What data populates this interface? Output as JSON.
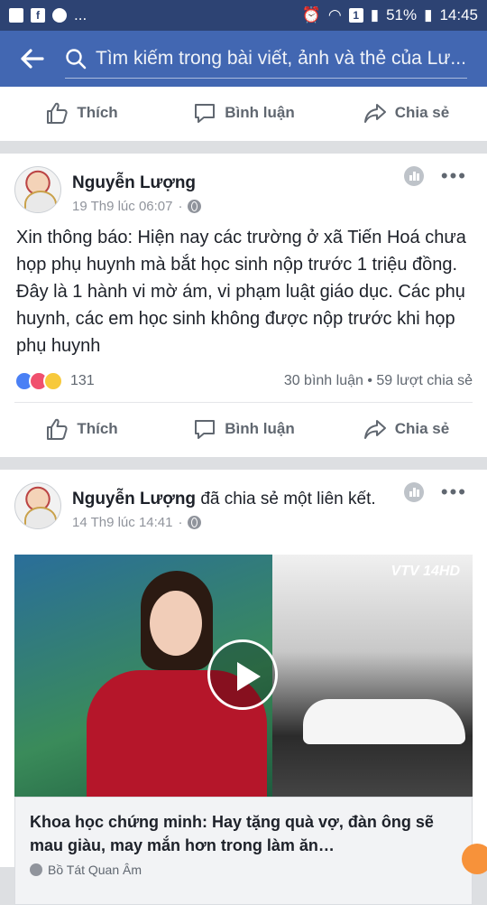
{
  "status_bar": {
    "left_icons": [
      "image-icon",
      "facebook-icon",
      "messenger-icon"
    ],
    "dots": "...",
    "network_badge": "1",
    "battery": "51%",
    "time": "14:45"
  },
  "search": {
    "placeholder": "Tìm kiếm trong bài viết, ảnh và thẻ của Lư..."
  },
  "actions": {
    "like": "Thích",
    "comment": "Bình luận",
    "share": "Chia sẻ"
  },
  "post1": {
    "author": "Nguyễn Lượng",
    "time": "19 Th9 lúc 06:07",
    "dot": "·",
    "text": "Xin thông báo: Hiện nay các trường ở xã Tiến Hoá chưa họp phụ huynh mà bắt học sinh nộp trước 1 triệu đồng. Đây là 1 hành vi mờ ám, vi phạm luật giáo dục. Các phụ huynh, các em học sinh không được nộp trước khi họp phụ huynh",
    "reaction_count": "131",
    "comments": "30 bình luận",
    "separator": "•",
    "shares": "59 lượt chia sẻ"
  },
  "post2": {
    "author": "Nguyễn Lượng",
    "action": "đã chia sẻ một liên kết.",
    "time": "14 Th9 lúc 14:41",
    "dot": "·",
    "video_logo": "VTV 14HD",
    "link_title": "Khoa học chứng minh: Hay tặng quà vợ, đàn ông sẽ mau giàu, may mắn hơn trong làm ăn…",
    "link_source": "Bồ Tát Quan Âm"
  },
  "colors": {
    "fb_blue": "#4267b2",
    "status_bar": "#2d4373",
    "text_gray": "#606770",
    "meta_gray": "#90949c"
  }
}
